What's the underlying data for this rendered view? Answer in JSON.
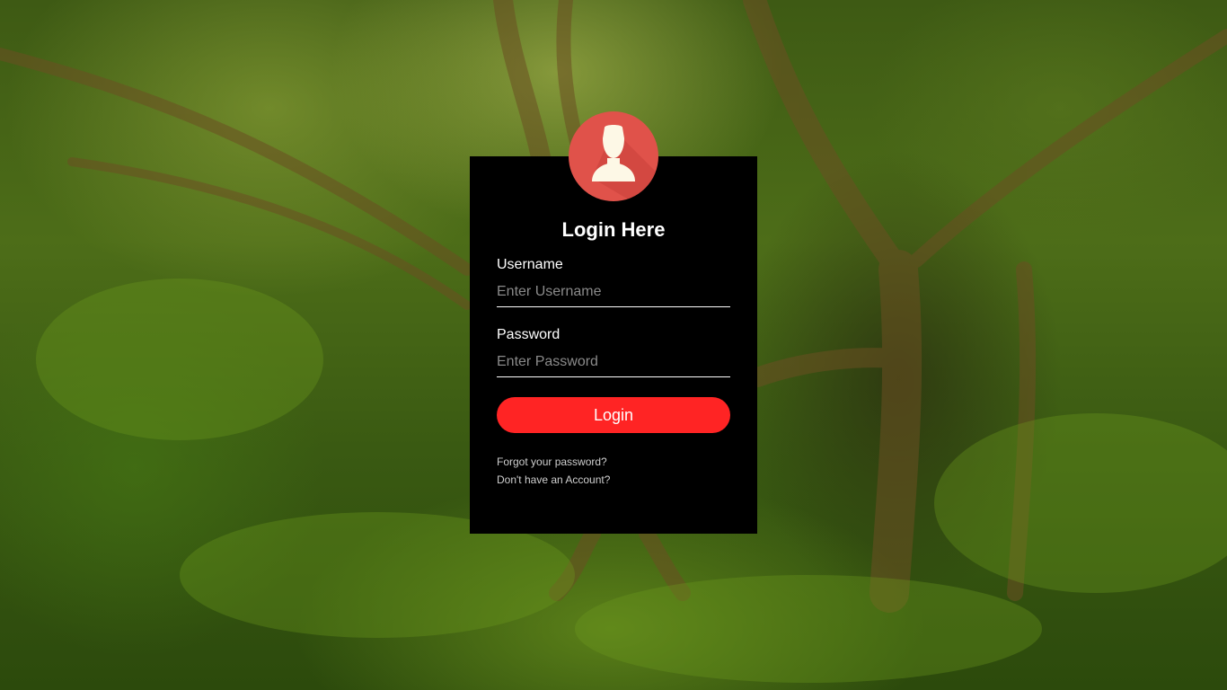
{
  "form": {
    "title": "Login Here",
    "username": {
      "label": "Username",
      "placeholder": "Enter Username",
      "value": ""
    },
    "password": {
      "label": "Password",
      "placeholder": "Enter Password",
      "value": ""
    },
    "login_label": "Login",
    "forgot_link": "Forgot your password?",
    "signup_link": "Don't have an Account?"
  },
  "icons": {
    "avatar": "user-avatar-icon"
  },
  "colors": {
    "card_background": "#000000",
    "accent": "#ff2424",
    "avatar_background": "#e0524a",
    "avatar_figure": "#fdf8e6"
  }
}
